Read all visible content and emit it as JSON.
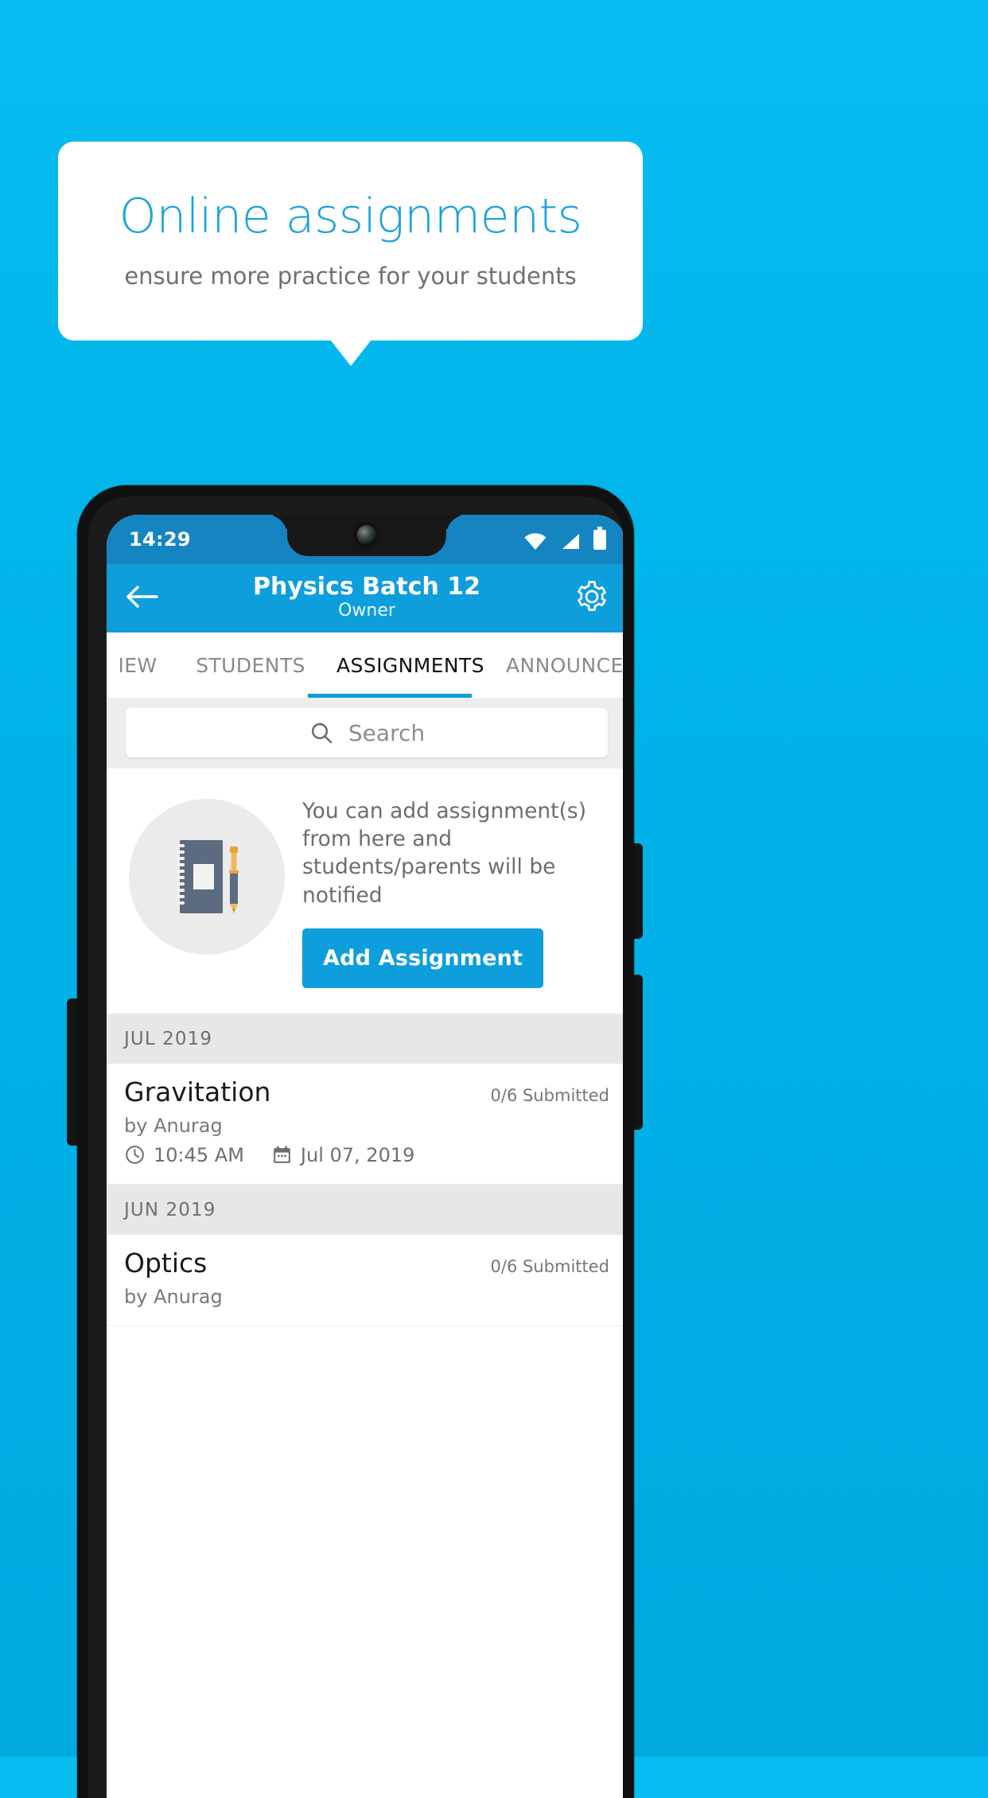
{
  "promo": {
    "title": "Online assignments",
    "subtitle": "ensure more practice for your students",
    "title_color": "#1CA3DE",
    "card_bg": "#FFFFFF",
    "page_bg": "#00B2E8"
  },
  "phone": {
    "statusbar": {
      "time": "14:29",
      "icons": [
        "wifi-icon",
        "cellular-signal-icon",
        "battery-icon"
      ],
      "bg": "#1585C2"
    },
    "appbar": {
      "back_icon": "back-arrow-icon",
      "title": "Physics Batch 12",
      "subtitle": "Owner",
      "settings_icon": "gear-icon",
      "bg": "#0E9EDC"
    },
    "tabs": {
      "items": [
        {
          "label": "IEW",
          "active": false
        },
        {
          "label": "STUDENTS",
          "active": false
        },
        {
          "label": "ASSIGNMENTS",
          "active": true
        },
        {
          "label": "ANNOUNCEM",
          "active": false
        }
      ],
      "active_color": "#0E9EDC"
    },
    "search": {
      "icon": "search-icon",
      "placeholder": "Search",
      "value": ""
    },
    "empty_state": {
      "illustration": "notebook-and-pen-icon",
      "text": "You can add assignment(s) from here and students/parents will be notified",
      "button_label": "Add Assignment"
    },
    "assignments": [
      {
        "month": "JUL 2019",
        "title": "Gravitation",
        "submitted": "0/6 Submitted",
        "author": "by Anurag",
        "time_icon": "clock-icon",
        "time": "10:45 AM",
        "date_icon": "calendar-icon",
        "date": "Jul 07, 2019"
      },
      {
        "month": "JUN 2019",
        "title": "Optics",
        "submitted": "0/6 Submitted",
        "author": "by Anurag",
        "time_icon": "clock-icon",
        "time": "",
        "date_icon": "calendar-icon",
        "date": ""
      }
    ]
  }
}
